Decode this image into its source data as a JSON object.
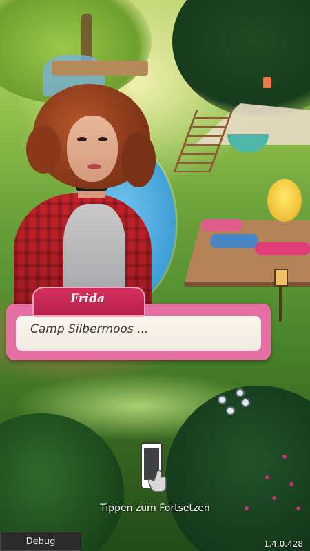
{
  "dialogue": {
    "speaker": "Frida",
    "text": "Camp Silbermoos ..."
  },
  "hint": {
    "text": "Tippen zum Fortsetzen",
    "icon": "tap-phone-icon"
  },
  "footer": {
    "debug_label": "Debug",
    "version": "1.4.0.428"
  },
  "colors": {
    "name_tag": "#c8284f",
    "dialogue_frame": "#e66fa4",
    "dialogue_bg": "#f7f1e8",
    "jacket": "#b81e25"
  }
}
